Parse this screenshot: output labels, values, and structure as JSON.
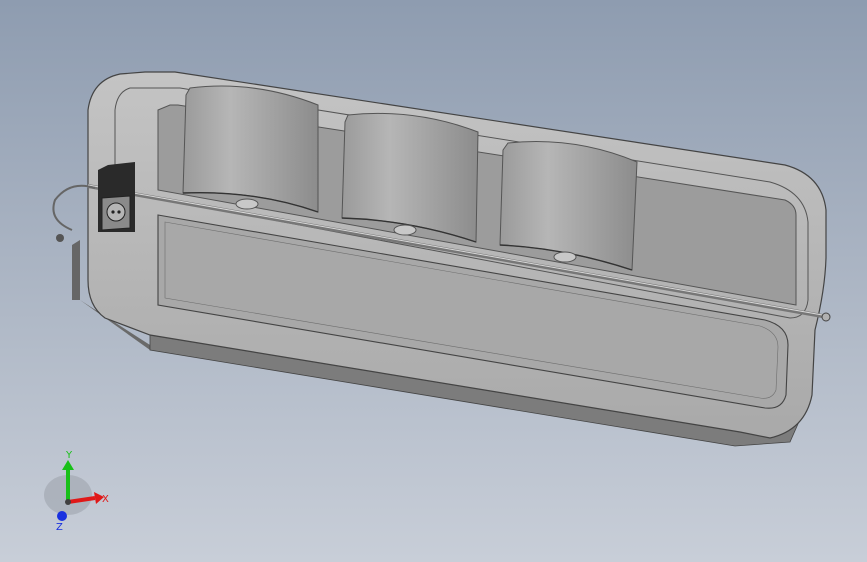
{
  "viewport": {
    "background_top": "#8e9cb0",
    "background_bottom": "#c8ced8"
  },
  "model": {
    "body_color": "#a3a3a3",
    "roller_count": 3
  },
  "triad": {
    "x_label": "X",
    "y_label": "Y",
    "z_label": "Z",
    "x_color": "#e01818",
    "y_color": "#18c018",
    "z_color": "#1830e0"
  }
}
